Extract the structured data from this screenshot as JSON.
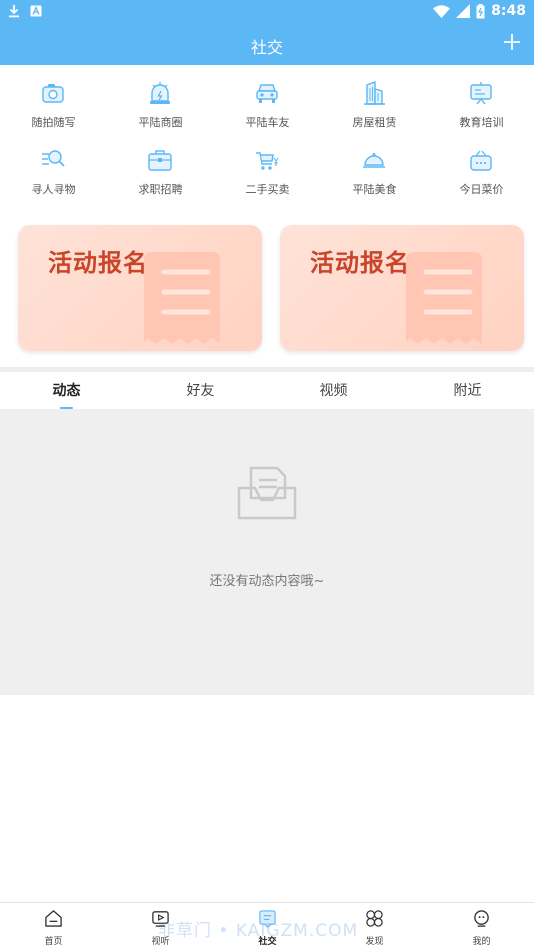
{
  "status_bar": {
    "time": "8:48",
    "icons": [
      "download-icon",
      "a-badge-icon",
      "wifi-icon",
      "signal-icon",
      "battery-icon"
    ]
  },
  "header": {
    "title": "社交",
    "action_icon": "plus-icon"
  },
  "categories": [
    {
      "label": "随拍随写",
      "icon": "camera-icon"
    },
    {
      "label": "平陆商圈",
      "icon": "alarm-icon"
    },
    {
      "label": "平陆车友",
      "icon": "car-icon"
    },
    {
      "label": "房屋租赁",
      "icon": "building-icon"
    },
    {
      "label": "教育培训",
      "icon": "presentation-icon"
    },
    {
      "label": "寻人寻物",
      "icon": "search-list-icon"
    },
    {
      "label": "求职招聘",
      "icon": "briefcase-icon"
    },
    {
      "label": "二手买卖",
      "icon": "cart-yen-icon"
    },
    {
      "label": "平陆美食",
      "icon": "food-cloche-icon"
    },
    {
      "label": "今日菜价",
      "icon": "basket-icon"
    }
  ],
  "banners": [
    {
      "title": "活动报名",
      "icon": "receipt-icon"
    },
    {
      "title": "活动报名",
      "icon": "receipt-icon"
    }
  ],
  "tabs": [
    {
      "label": "动态",
      "active": true
    },
    {
      "label": "好友",
      "active": false
    },
    {
      "label": "视频",
      "active": false
    },
    {
      "label": "附近",
      "active": false
    }
  ],
  "feed": {
    "empty_text": "还没有动态内容哦~",
    "empty_icon": "inbox-icon"
  },
  "bottom_nav": [
    {
      "label": "首页",
      "icon": "home-icon",
      "active": false
    },
    {
      "label": "视听",
      "icon": "video-play-icon",
      "active": false
    },
    {
      "label": "社交",
      "icon": "chat-doc-icon",
      "active": true
    },
    {
      "label": "发现",
      "icon": "discover-grid-icon",
      "active": false
    },
    {
      "label": "我的",
      "icon": "profile-icon",
      "active": false
    }
  ],
  "watermark": "非草门 • KAIGZM.COM",
  "colors": {
    "primary": "#5bb8f5",
    "banner_text": "#c8452a",
    "banner_bg": "#ffd9cb",
    "feed_bg": "#efefef"
  }
}
